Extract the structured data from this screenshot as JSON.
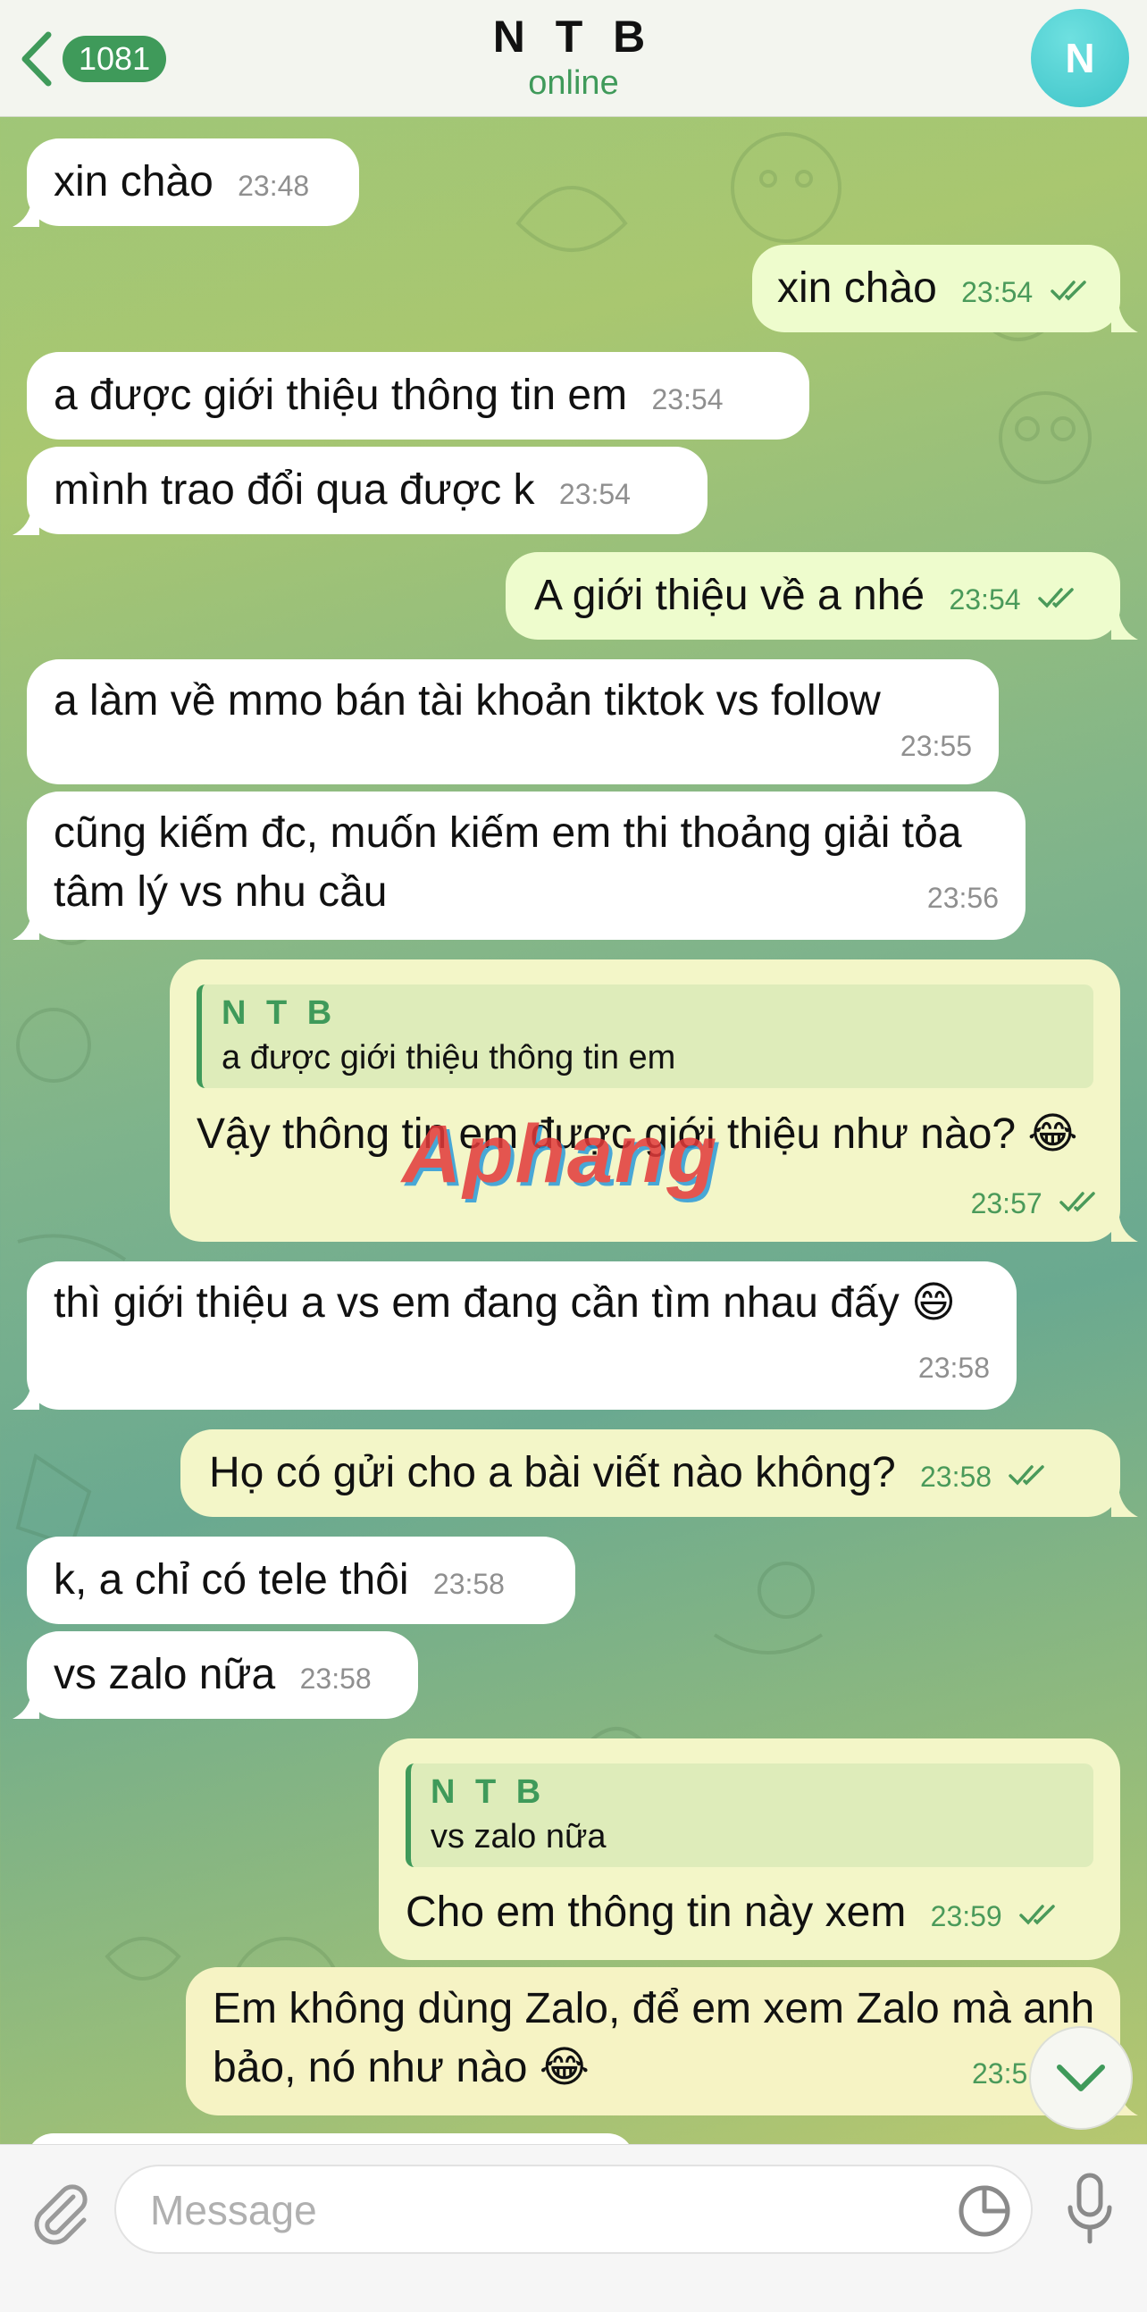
{
  "header": {
    "back_count": "1081",
    "title": "N T B",
    "status": "online",
    "avatar_initial": "N",
    "avatar_color": "#46c8cb"
  },
  "messages": [
    {
      "dir": "in",
      "text": "xin chào",
      "time": "23:48"
    },
    {
      "dir": "out",
      "text": "xin chào",
      "time": "23:54"
    },
    {
      "dir": "in",
      "text": "a được giới thiệu thông tin em",
      "time": "23:54"
    },
    {
      "dir": "in",
      "text": "mình trao đổi qua được k",
      "time": "23:54"
    },
    {
      "dir": "out",
      "text": "A giới thiệu về a nhé",
      "time": "23:54"
    },
    {
      "dir": "in",
      "text": "a làm về mmo bán tài khoản tiktok vs follow",
      "time": "23:55"
    },
    {
      "dir": "in",
      "text": "cũng kiếm đc, muốn kiếm em thi thoảng giải tỏa tâm lý vs nhu cầu",
      "time": "23:56"
    },
    {
      "dir": "out",
      "reply_name": "N T B",
      "reply_text": "a được giới thiệu thông tin em",
      "text": "Vậy thông tin em được giới thiệu như nào? 😂",
      "time": "23:57"
    },
    {
      "dir": "in",
      "text": "thì giới thiệu a vs em đang cần tìm nhau đấy 😄",
      "time": "23:58"
    },
    {
      "dir": "out",
      "text": "Họ có gửi cho a bài viết nào không?",
      "time": "23:58"
    },
    {
      "dir": "in",
      "text": "k, a chỉ có tele thôi",
      "time": "23:58"
    },
    {
      "dir": "in",
      "text": "vs zalo nữa",
      "time": "23:58"
    },
    {
      "dir": "out",
      "reply_name": "N T B",
      "reply_text": "vs zalo nữa",
      "text": "Cho em thông tin này xem",
      "time": "23:59"
    },
    {
      "dir": "out",
      "text": "Em không dùng Zalo, để em xem Zalo mà anh bảo, nó như nào 😂",
      "time": "23:5"
    }
  ],
  "watermark": "Aphang",
  "composer": {
    "placeholder": "Message"
  },
  "colors": {
    "accent": "#3f9a5a",
    "incoming_bubble": "#ffffff",
    "outgoing_bubble": "#eefccd"
  }
}
